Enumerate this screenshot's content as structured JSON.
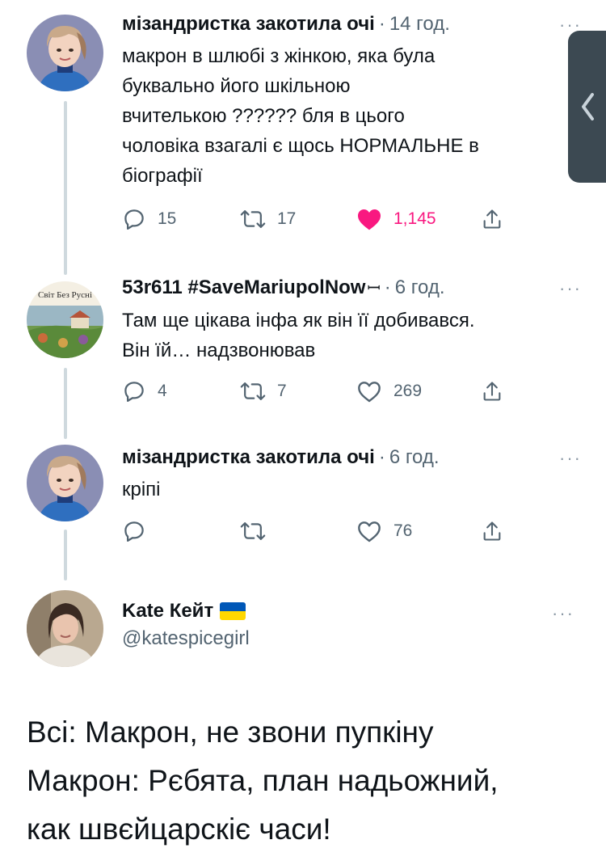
{
  "colors": {
    "like_active": "#f91880",
    "secondary_text": "#536471",
    "thread_line": "#cfd9de",
    "side_handle": "#3c4952",
    "flag_blue": "#0057b7",
    "flag_yellow": "#ffd700"
  },
  "tweets": [
    {
      "author": "мізандристка закотила очі",
      "separator": "·",
      "time": "14 год.",
      "text": "макрон в шлюбі з жінкою, яка була\nбуквально його шкільною\nвчителькою ?????? бля в цього\nчоловіка взагалі є щось НОРМАЛЬНЕ в\nбіографії",
      "more": "···",
      "replies": "15",
      "retweets": "17",
      "likes": "1,145",
      "liked": true,
      "avatar_icon": "person-avatar-icon"
    },
    {
      "author": "53r611 #SaveMariupolNow",
      "author_suffix": "ꟷ",
      "separator": "·",
      "time": "6 год.",
      "text": "Там ще цікава інфа як він її добивався.\nВін їй… надзвонював",
      "more": "···",
      "replies": "4",
      "retweets": "7",
      "likes": "269",
      "liked": false,
      "avatar_caption": "Світ Без Русні"
    },
    {
      "author": "мізандристка закотила очі",
      "separator": "·",
      "time": "6 год.",
      "text": "кріпі",
      "more": "···",
      "replies": "",
      "retweets": "",
      "likes": "76",
      "liked": false
    }
  ],
  "main_tweet": {
    "author": "Kate Кейт",
    "flag_icon": "ukraine-flag-icon",
    "handle": "@katespicegirl",
    "more": "···",
    "text": "Всі: Макрон, не звони пупкіну\nМакрон: Рєбята, план надьожний,\nкак швєйцарскіє часи!"
  },
  "side_handle": {
    "icon": "chevron-left-icon"
  }
}
